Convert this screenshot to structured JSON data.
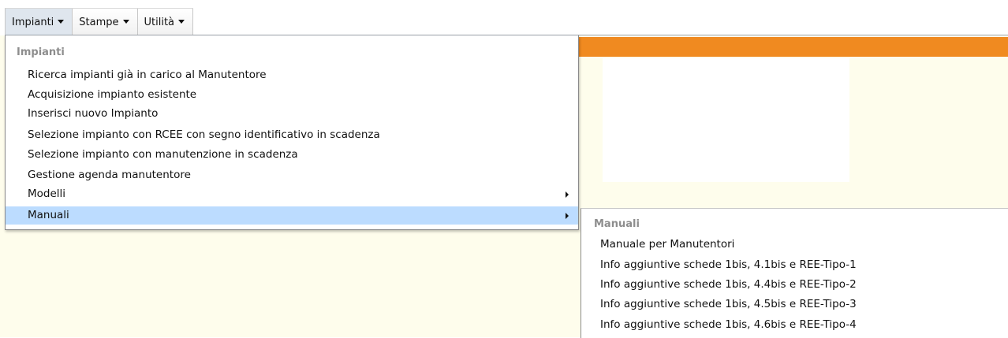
{
  "menubar": {
    "items": [
      {
        "label": "Impianti"
      },
      {
        "label": "Stampe"
      },
      {
        "label": "Utilità"
      }
    ]
  },
  "dropdown": {
    "header": "Impianti",
    "items": [
      {
        "label": "Ricerca impianti già in carico al Manutentore"
      },
      {
        "label": "Acquisizione impianto esistente"
      },
      {
        "label": "Inserisci nuovo Impianto"
      },
      {
        "label": "Selezione impianto con RCEE con segno identificativo in scadenza"
      },
      {
        "label": "Selezione impianto con manutenzione in scadenza"
      },
      {
        "label": "Gestione agenda manutentore"
      },
      {
        "label": "Modelli"
      },
      {
        "label": "Manuali"
      }
    ]
  },
  "submenu": {
    "header": "Manuali",
    "items": [
      {
        "label": "Manuale per Manutentori"
      },
      {
        "label": "Info aggiuntive schede 1bis, 4.1bis e REE-Tipo-1"
      },
      {
        "label": "Info aggiuntive schede 1bis, 4.4bis e REE-Tipo-2"
      },
      {
        "label": "Info aggiuntive schede 1bis, 4.5bis e REE-Tipo-3"
      },
      {
        "label": "Info aggiuntive schede 1bis, 4.6bis e REE-Tipo-4"
      }
    ]
  },
  "colors": {
    "accent_bar": "#f08a20",
    "page_background": "#fefdec",
    "highlight": "#bcdcff"
  }
}
